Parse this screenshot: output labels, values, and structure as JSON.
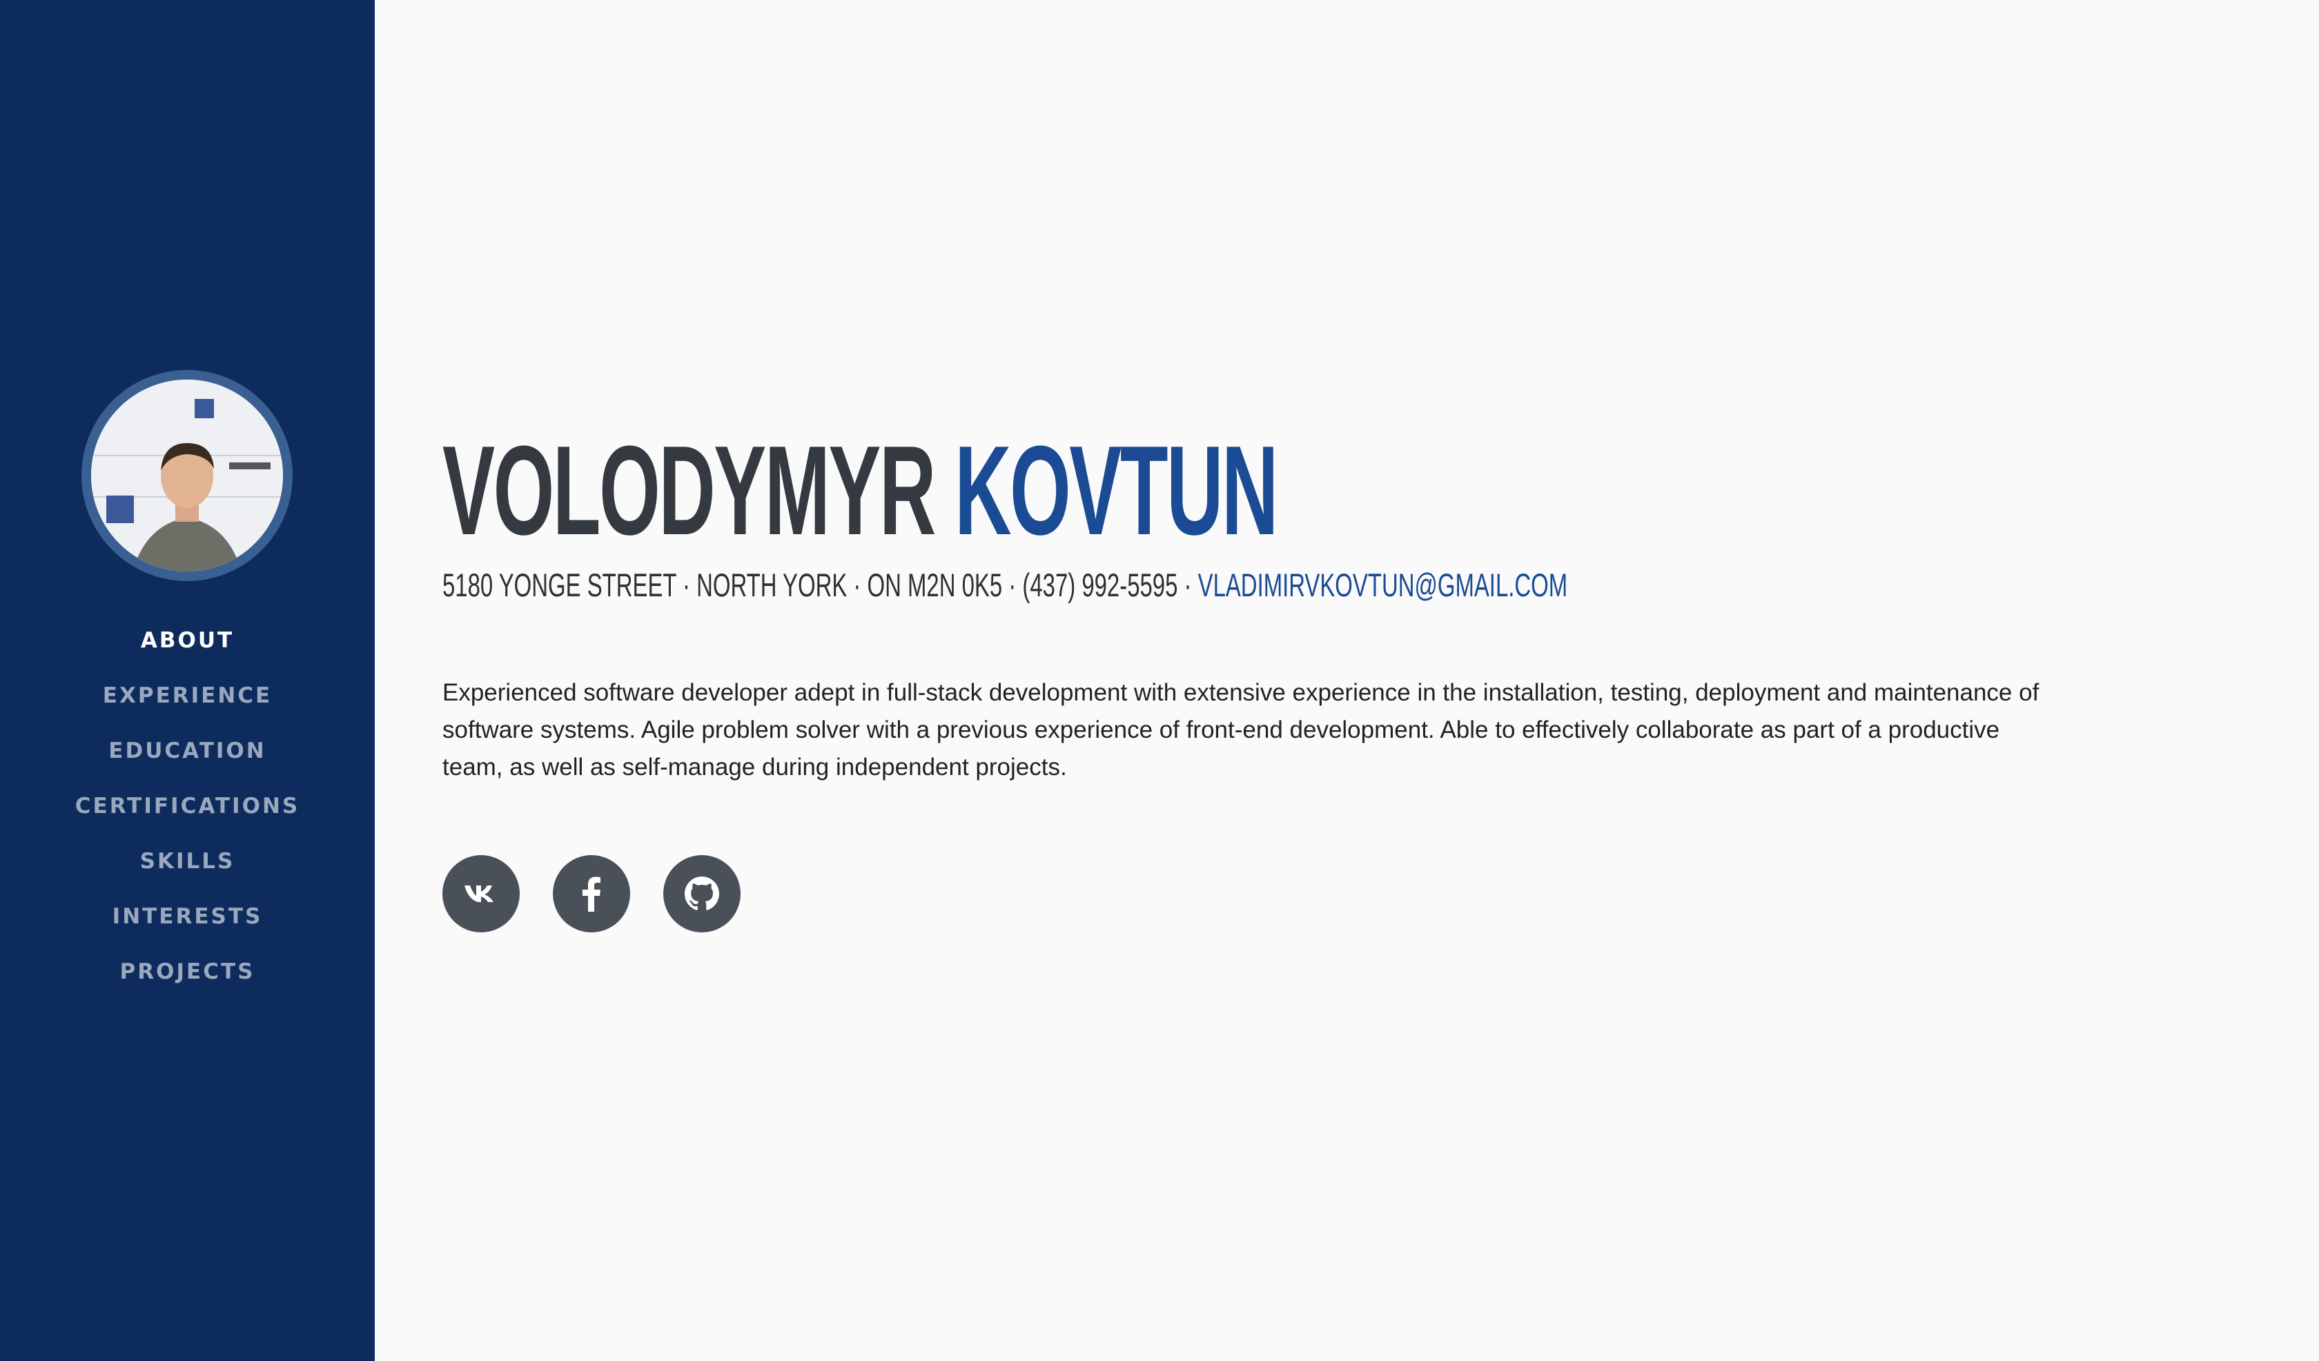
{
  "sidebar": {
    "avatar_alt": "profile photo",
    "nav": [
      {
        "label": "ABOUT",
        "active": true
      },
      {
        "label": "EXPERIENCE",
        "active": false
      },
      {
        "label": "EDUCATION",
        "active": false
      },
      {
        "label": "CERTIFICATIONS",
        "active": false
      },
      {
        "label": "SKILLS",
        "active": false
      },
      {
        "label": "INTERESTS",
        "active": false
      },
      {
        "label": "PROJECTS",
        "active": false
      }
    ]
  },
  "header": {
    "first_name": "VOLODYMYR",
    "last_name": "KOVTUN",
    "contact_text": "5180 YONGE STREET · NORTH YORK · ON M2N 0K5 · (437) 992-5595 · ",
    "email": "VLADIMIRVKOVTUN@GMAIL.COM"
  },
  "about": {
    "text": "Experienced software developer adept in full-stack development with extensive experience in the installation, testing, deployment and maintenance of software systems. Agile problem solver with a previous experience of front-end development. Able to effectively collaborate as part of a productive team, as well as self-manage during independent projects."
  },
  "social": [
    {
      "icon": "vk-icon"
    },
    {
      "icon": "facebook-icon"
    },
    {
      "icon": "github-icon"
    }
  ],
  "colors": {
    "sidebar_bg": "#0d2b5c",
    "accent": "#1a4b94",
    "heading": "#343a40",
    "social_bg": "#495057",
    "nav_inactive": "#9aa8be"
  }
}
